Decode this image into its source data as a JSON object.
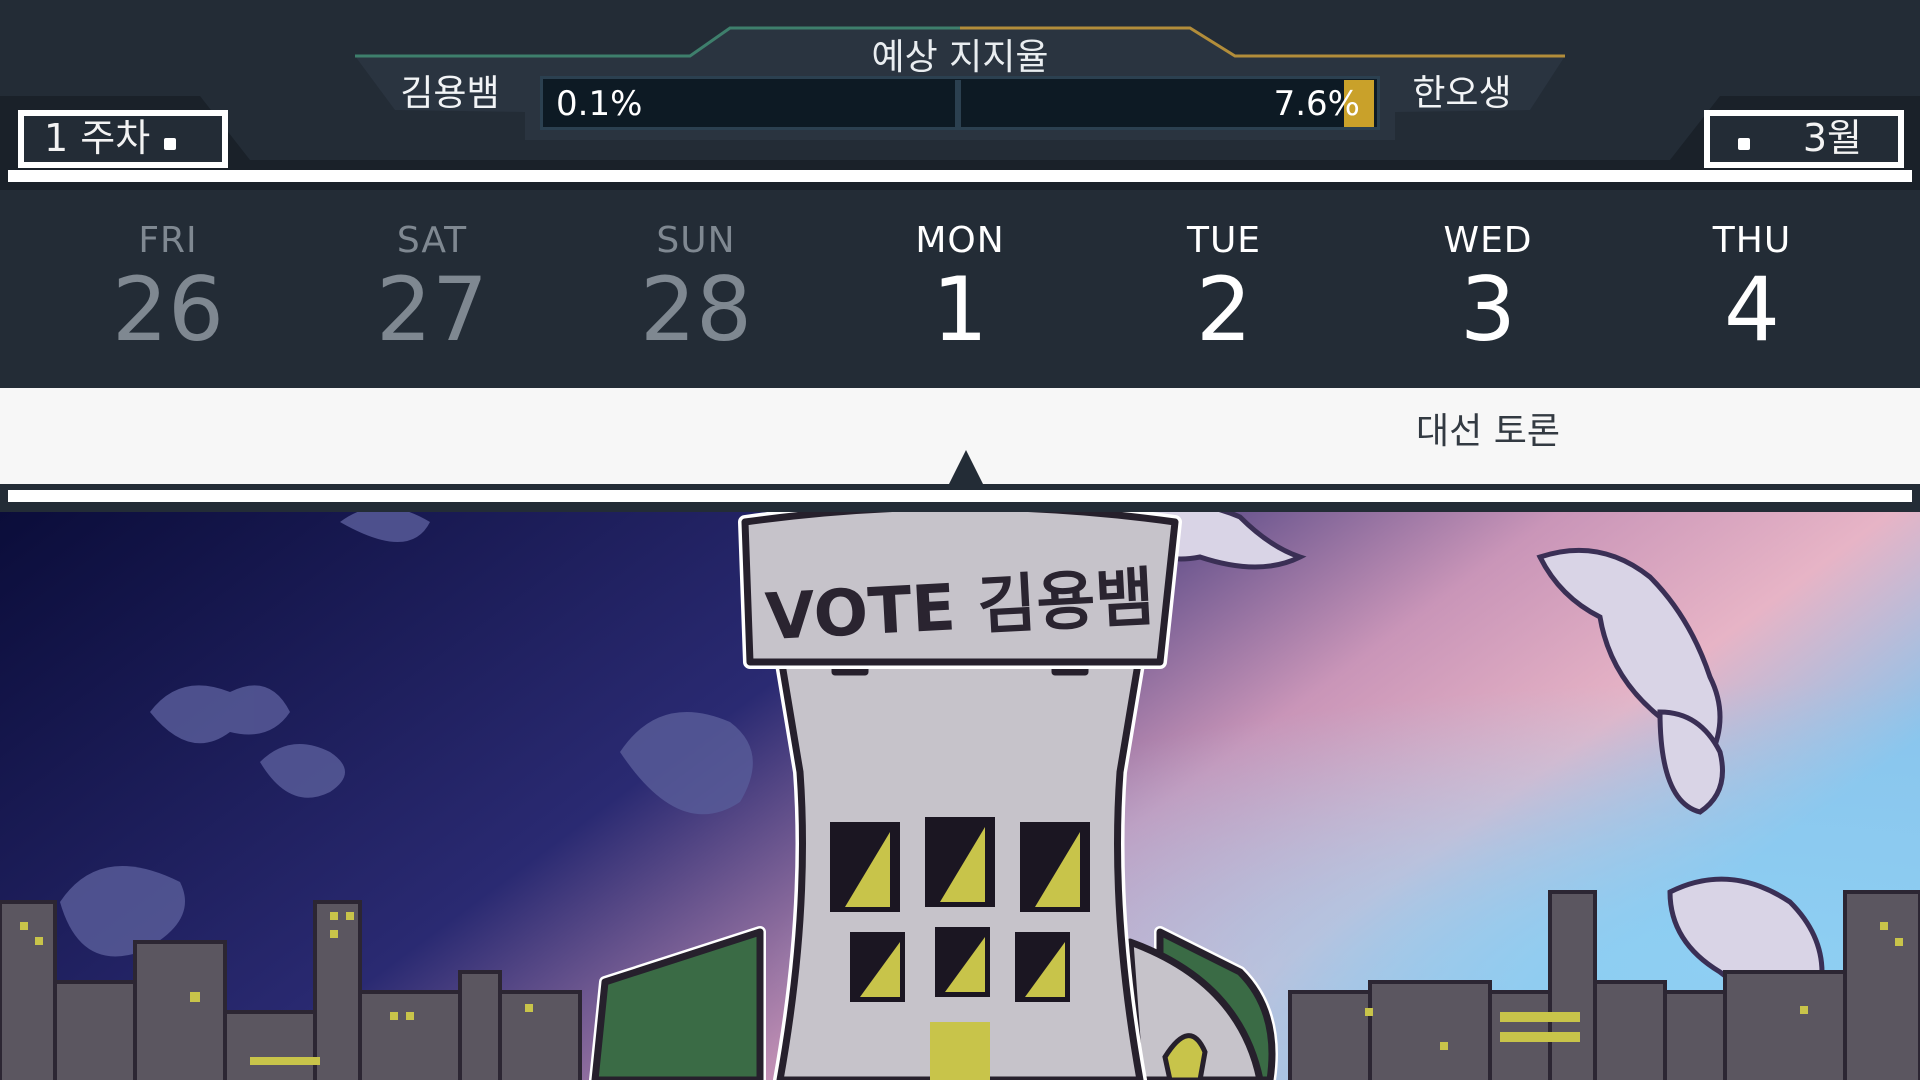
{
  "poll": {
    "title": "예상 지지율",
    "left_candidate": "김용뱀",
    "right_candidate": "한오생",
    "left_percent": "0.1%",
    "right_percent": "7.6%",
    "right_fill_fraction": 0.076
  },
  "week_tab": {
    "label": "1 주차"
  },
  "month_tab": {
    "label": "3월"
  },
  "calendar": {
    "days": [
      {
        "name": "FRI",
        "num": "26",
        "state": "past"
      },
      {
        "name": "SAT",
        "num": "27",
        "state": "past"
      },
      {
        "name": "SUN",
        "num": "28",
        "state": "past"
      },
      {
        "name": "MON",
        "num": "1",
        "state": "current"
      },
      {
        "name": "TUE",
        "num": "2",
        "state": "current"
      },
      {
        "name": "WED",
        "num": "3",
        "state": "current"
      },
      {
        "name": "THU",
        "num": "4",
        "state": "current"
      }
    ]
  },
  "event": {
    "label": "대선 토론"
  },
  "scene": {
    "sign_text": "VOTE 김용뱀"
  },
  "colors": {
    "accent_gold": "#c9a12a",
    "window_yellow": "#c8c44a",
    "roof_green": "#3a6b45",
    "panel_dark": "#232c36"
  }
}
